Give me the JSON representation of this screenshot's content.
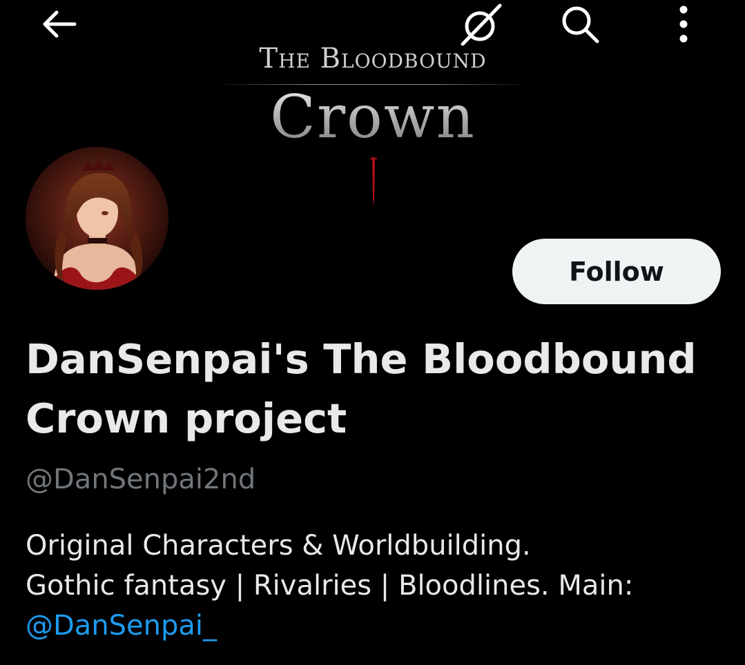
{
  "topbar": {
    "back_icon": "arrow-left-icon",
    "mute_icon": "muted-slash-icon",
    "search_icon": "search-icon",
    "more_icon": "more-vertical-icon"
  },
  "banner": {
    "logo_line1": "The Bloodbound",
    "logo_line2": "Crown"
  },
  "profile": {
    "follow_label": "Follow",
    "display_name": "DanSenpai's The Bloodbound Crown project",
    "handle": "@DanSenpai2nd",
    "bio_line1": "Original Characters & Worldbuilding.",
    "bio_line2": "Gothic fantasy | Rivalries | Bloodlines. Main:",
    "bio_mention": "@DanSenpai_"
  },
  "colors": {
    "background": "#000000",
    "primary_text": "#e7e9ea",
    "secondary_text": "#71767b",
    "link": "#1d9bf0",
    "follow_bg": "#eff3f4",
    "follow_text": "#0f1419",
    "blood_red": "#b0101a"
  }
}
